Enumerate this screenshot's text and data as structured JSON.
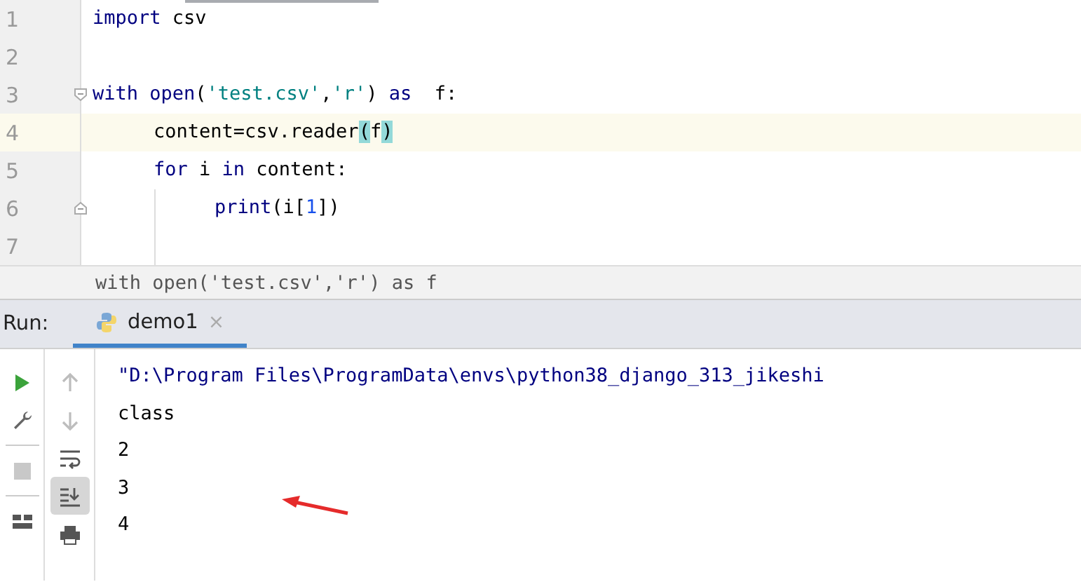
{
  "editor": {
    "lines": [
      {
        "number": "1",
        "kind": "code",
        "current": false,
        "tokens": [
          {
            "kind": "keyword",
            "text": "import"
          },
          {
            "kind": "plain",
            "text": " csv"
          }
        ]
      },
      {
        "number": "2",
        "kind": "code",
        "current": false
      },
      {
        "number": "3",
        "kind": "fold-start",
        "current": false,
        "tokens": [
          {
            "kind": "keyword",
            "text": "with"
          },
          {
            "kind": "builtin",
            "text": " open"
          },
          {
            "kind": "plain",
            "text": "("
          },
          {
            "kind": "string",
            "text": "'test.csv'"
          },
          {
            "kind": "plain",
            "text": ","
          },
          {
            "kind": "string",
            "text": "'r'"
          },
          {
            "kind": "plain",
            "text": ") "
          },
          {
            "kind": "keyword",
            "text": "as"
          },
          {
            "kind": "plain",
            "text": "  f:"
          }
        ],
        "children": [
          {
            "number": "4",
            "kind": "code",
            "current": true,
            "tokens": [
              {
                "kind": "plain",
                "text": "content=csv.reader"
              },
              {
                "kind": "match",
                "text": "("
              },
              {
                "kind": "plain",
                "text": "f"
              },
              {
                "kind": "match",
                "text": ")"
              }
            ]
          },
          {
            "number": "5",
            "kind": "code",
            "current": false,
            "tokens": [
              {
                "kind": "keyword",
                "text": "for"
              },
              {
                "kind": "plain",
                "text": " i "
              },
              {
                "kind": "keyword",
                "text": "in"
              },
              {
                "kind": "plain",
                "text": " content:"
              }
            ],
            "children": [
              {
                "number": "6",
                "kind": "fold-end",
                "current": false,
                "tokens": [
                  {
                    "kind": "builtin",
                    "text": "print"
                  },
                  {
                    "kind": "plain",
                    "text": "(i["
                  },
                  {
                    "kind": "number",
                    "text": "1"
                  },
                  {
                    "kind": "plain",
                    "text": "])"
                  }
                ]
              },
              {
                "number": "7",
                "kind": "code",
                "current": false
              }
            ]
          }
        ]
      }
    ],
    "breadcrumb": "with open('test.csv','r') as f"
  },
  "run_panel": {
    "label": "Run:",
    "tabs": [
      {
        "label": "demo1",
        "selected": true,
        "close": "×"
      }
    ],
    "toolbar_left": [
      {
        "kind": "run",
        "disabled": false
      },
      {
        "kind": "wrench",
        "disabled": false
      },
      {
        "kind": "stop",
        "disabled": true
      },
      {
        "kind": "layout",
        "disabled": false
      }
    ],
    "toolbar_right": [
      {
        "kind": "up",
        "disabled": true
      },
      {
        "kind": "down",
        "disabled": true
      },
      {
        "kind": "wrap",
        "selected": false
      },
      {
        "kind": "scroll-end",
        "selected": true
      },
      {
        "kind": "print",
        "selected": false
      }
    ],
    "output": [
      {
        "kind": "command",
        "text": "\"D:\\Program Files\\ProgramData\\envs\\python38_django_313_jikeshi"
      },
      {
        "kind": "stdout",
        "text": "class"
      },
      {
        "kind": "stdout",
        "text": "2"
      },
      {
        "kind": "stdout",
        "text": "3"
      },
      {
        "kind": "stdout",
        "text": "4"
      }
    ]
  }
}
